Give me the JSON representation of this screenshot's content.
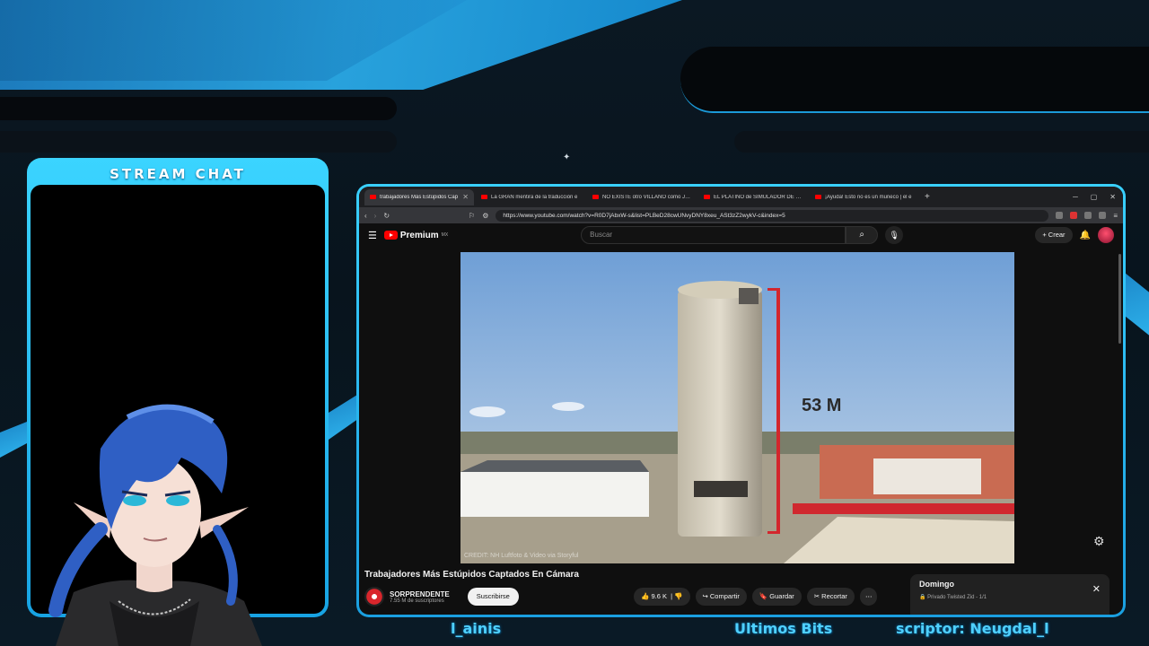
{
  "overlay": {
    "chat_title": "STREAM CHAT",
    "ticker_left": "l_ainis",
    "ticker_center": "Ultimos Bits",
    "ticker_right": "scriptor: Neugdal_l"
  },
  "browser": {
    "tabs": [
      {
        "label": "trabajadores Más Estúpidos Cap",
        "active": true
      },
      {
        "label": "La GRAN mentira de la traducción e",
        "active": false
      },
      {
        "label": "NO EXISTE otro VILLANO como JOH",
        "active": false
      },
      {
        "label": "EL PLATINO de SIMULADOR DE VAC",
        "active": false
      },
      {
        "label": "¡Ayuda! Esto no es un muñeco | el e",
        "active": false
      }
    ],
    "url": "https://www.youtube.com/watch?v=R0D7jAbxW-s&list=PLBeD28cwUNvyDNY8xeu_ASt3zZ2wykV-c&index=5"
  },
  "youtube": {
    "logo": "Premium",
    "region": "MX",
    "search_placeholder": "Buscar",
    "create_label": "Crear",
    "video": {
      "overlay_label": "53 M",
      "credit": "CREDIT: NH Luftfoto & Video via Storyful"
    },
    "title": "Trabajadores Más Estúpidos Captados En Cámara",
    "channel": {
      "name": "SORPRENDENTE",
      "subscribers": "7.55 M de suscriptores",
      "subscribe_label": "Suscribirse"
    },
    "actions": {
      "likes": "9.6 K",
      "share": "Compartir",
      "save": "Guardar",
      "clip": "Recortar"
    },
    "playlist": {
      "title": "Domingo",
      "meta": "Privado Twisted Zid - 1/1"
    }
  }
}
